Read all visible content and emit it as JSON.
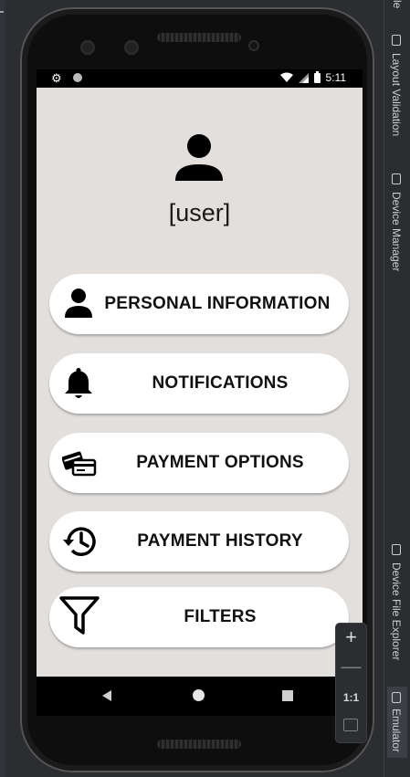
{
  "ide": {
    "right_tabs": [
      {
        "label": "Layout Validation",
        "icon": "layout-validation-icon"
      },
      {
        "label": "Device Manager",
        "icon": "device-manager-icon"
      },
      {
        "label": "Device File Explorer",
        "icon": "device-file-explorer-icon"
      },
      {
        "label": "Emulator",
        "icon": "emulator-icon"
      }
    ],
    "top_right_fragment": "le",
    "emulator_toolbar": {
      "zoom_in": "+",
      "zoom_out": "—",
      "ratio": "1:1",
      "fit": "fit-screen-icon"
    }
  },
  "status_bar": {
    "time": "5:11",
    "left_icons": [
      "settings-gear-icon",
      "notification-dot-icon"
    ],
    "right_icons": [
      "wifi-icon",
      "signal-icon",
      "battery-icon"
    ]
  },
  "profile": {
    "username": "[user]",
    "avatar_icon": "person-icon"
  },
  "menu": [
    {
      "label": "PERSONAL INFORMATION",
      "icon": "person-icon"
    },
    {
      "label": "NOTIFICATIONS",
      "icon": "bell-icon"
    },
    {
      "label": "PAYMENT OPTIONS",
      "icon": "credit-cards-icon"
    },
    {
      "label": "PAYMENT HISTORY",
      "icon": "history-icon"
    },
    {
      "label": "FILTERS",
      "icon": "filter-funnel-icon"
    }
  ],
  "nav_bar": [
    "back-icon",
    "home-icon",
    "recents-icon"
  ],
  "colors": {
    "screen_background": "#e2dfdd",
    "button_background": "#ffffff",
    "ide_background": "#2b2d30"
  }
}
